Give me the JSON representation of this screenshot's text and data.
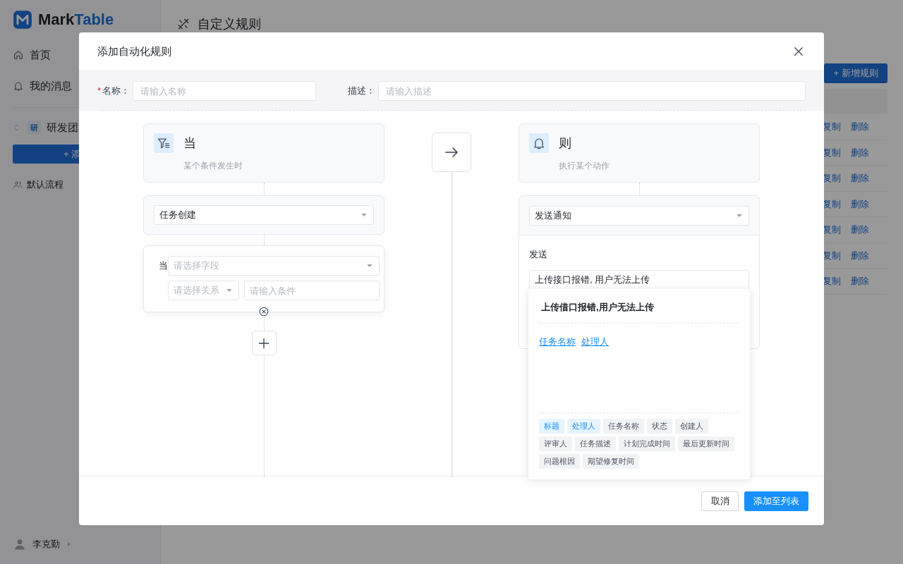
{
  "sidebar": {
    "logo": {
      "part_1": "Mark",
      "part_2": "Table"
    },
    "items": [
      {
        "label": "首页"
      },
      {
        "label": "我的消息"
      }
    ],
    "team": {
      "badge": "研",
      "name": "研发团"
    },
    "add_button": "+ 添",
    "flows": [
      {
        "label": "默认流程"
      }
    ],
    "user": {
      "name": "李克勤"
    }
  },
  "page": {
    "title": "自定义规则",
    "new_button": "+ 新增规则",
    "rows": [
      {
        "copy": "复制",
        "delete": "删除"
      },
      {
        "copy": "复制",
        "delete": "删除"
      },
      {
        "copy": "复制",
        "delete": "删除"
      },
      {
        "copy": "复制",
        "delete": "删除"
      },
      {
        "copy": "复制",
        "delete": "删除"
      },
      {
        "copy": "复制",
        "delete": "删除"
      },
      {
        "copy": "复制",
        "delete": "删除"
      }
    ]
  },
  "dialog": {
    "title": "添加自动化规则",
    "name_field": {
      "required_mark": "*",
      "label": "名称：",
      "placeholder": "请输入名称"
    },
    "description_field": {
      "label": "描述：",
      "placeholder": "请输入描述"
    },
    "trigger": {
      "title": "当",
      "subtitle": "某个条件发生时",
      "event": "任务创建",
      "condition": {
        "label": "当",
        "field_placeholder": "请选择字段",
        "relation_placeholder": "请选择关系",
        "value_placeholder": "请输入条件"
      }
    },
    "action": {
      "title": "则",
      "subtitle": "执行某个动作",
      "type": "发送通知",
      "send_label": "发送",
      "message": "上传接口报错, 用户无法上传",
      "popup": {
        "title": "上传借口报错,用户无法上传",
        "variables": [
          "任务名称",
          "处理人"
        ],
        "tags": [
          {
            "label": "标题",
            "selected": true
          },
          {
            "label": "处理人",
            "selected": true
          },
          {
            "label": "任务名称",
            "selected": false
          },
          {
            "label": "状态",
            "selected": false
          },
          {
            "label": "创建人",
            "selected": false
          },
          {
            "label": "评审人",
            "selected": false
          },
          {
            "label": "任务描述",
            "selected": false
          },
          {
            "label": "计划完成时间",
            "selected": false
          },
          {
            "label": "最后更新时间",
            "selected": false
          },
          {
            "label": "问题根因",
            "selected": false
          },
          {
            "label": "期望修复时间",
            "selected": false
          }
        ]
      }
    },
    "buttons": {
      "cancel": "取消",
      "submit": "添加至列表"
    }
  }
}
